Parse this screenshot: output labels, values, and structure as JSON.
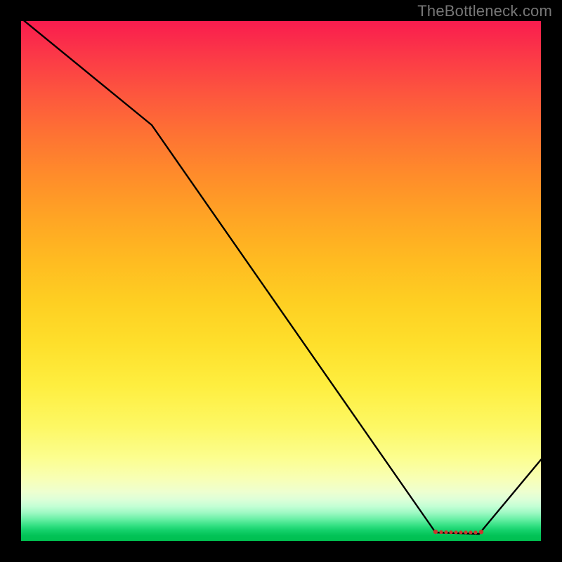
{
  "watermark": "TheBottleneck.com",
  "chart_data": {
    "type": "line",
    "title": "",
    "xlabel": "",
    "ylabel": "",
    "xlim": [
      0,
      100
    ],
    "ylim": [
      0,
      100
    ],
    "grid": false,
    "legend": false,
    "background_gradient": {
      "direction": "vertical",
      "stops": [
        {
          "pos": 0,
          "meaning": "far-from-optimal",
          "color": "#f91c4e"
        },
        {
          "pos": 50,
          "meaning": "mid",
          "color": "#ffc721"
        },
        {
          "pos": 90,
          "meaning": "near-optimal",
          "color": "#f4ffc6"
        },
        {
          "pos": 100,
          "meaning": "optimal",
          "color": "#00bf50"
        }
      ]
    },
    "series": [
      {
        "name": "bottleneck-curve",
        "color": "#000000",
        "x": [
          0,
          25,
          80,
          88,
          100
        ],
        "y_pct": [
          100,
          80,
          0,
          0,
          15
        ],
        "note": "y_pct is vertical position as % up from the bottom of the plot area; the curve dips to ~0 (green zone) between x≈80 and x≈88 marking the optimal range."
      }
    ],
    "optimal_marker": {
      "x_range": [
        80,
        88
      ],
      "color": "#d33a2f",
      "shape": "dotted-horizontal"
    }
  }
}
